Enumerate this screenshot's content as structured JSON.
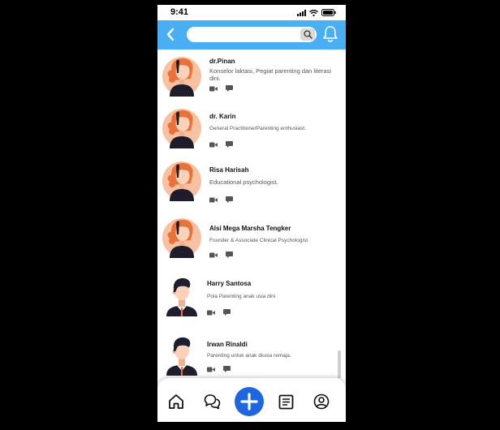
{
  "status_bar": {
    "time": "9:41"
  },
  "header": {
    "search_placeholder": "",
    "search_value": ""
  },
  "experts": [
    {
      "name": "dr.Pinan",
      "description": "Konselor laktasi, Pegiat parenting dan literasi dini.",
      "avatar": "woman-avatar"
    },
    {
      "name": "dr. Karin",
      "description": "General PractitionerParenting enthusiast.",
      "avatar": "woman-avatar"
    },
    {
      "name": "Risa Harisah",
      "description": "Educational psychologist.",
      "avatar": "woman-avatar"
    },
    {
      "name": "Alsi Mega Marsha Tengker",
      "description": "Founder & Associate Clinical Psychologist.",
      "avatar": "woman-avatar"
    },
    {
      "name": "Harry Santosa",
      "description": "Pola Parenting anak usia dini",
      "avatar": "man-avatar"
    },
    {
      "name": "Irwan Rinaldi",
      "description": "Parenting untuk anak diusia remaja.",
      "avatar": "man-avatar"
    }
  ],
  "item_actions": {
    "video_icon": "video-call-icon",
    "chat_icon": "chat-icon"
  },
  "bottom_nav": {
    "items": [
      "home-icon",
      "chat-bubbles-icon",
      "add-icon",
      "article-icon",
      "profile-icon"
    ],
    "fab_color": "#1e66e0"
  },
  "colors": {
    "header": "#4aaef3",
    "accent": "#1e66e0",
    "skin": "#f8c2a2",
    "hair_woman": "#e8733a",
    "hair_man": "#1e1e2e"
  }
}
